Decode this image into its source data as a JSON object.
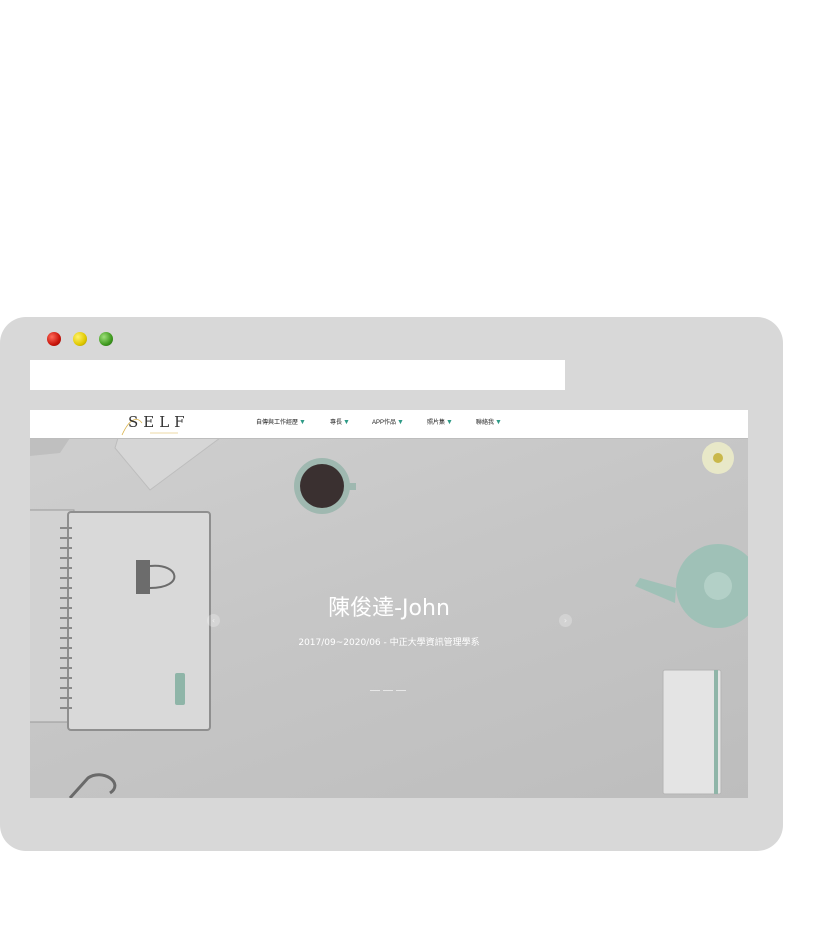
{
  "site": {
    "logo": "SELF",
    "nav": [
      {
        "label": "自傳與工作經歷"
      },
      {
        "label": "專長"
      },
      {
        "label": "APP作品"
      },
      {
        "label": "照片集"
      },
      {
        "label": "聯絡我"
      }
    ]
  },
  "hero": {
    "title": "陳俊達-John",
    "subtitle": "2017/09~2020/06 - 中正大學資訊管理學系",
    "prev_arrow": "‹",
    "next_arrow": "›"
  },
  "colors": {
    "frame": "#d8d8d8",
    "accent_caret": "#2e9a86",
    "teapot": "#9fc1b7"
  }
}
